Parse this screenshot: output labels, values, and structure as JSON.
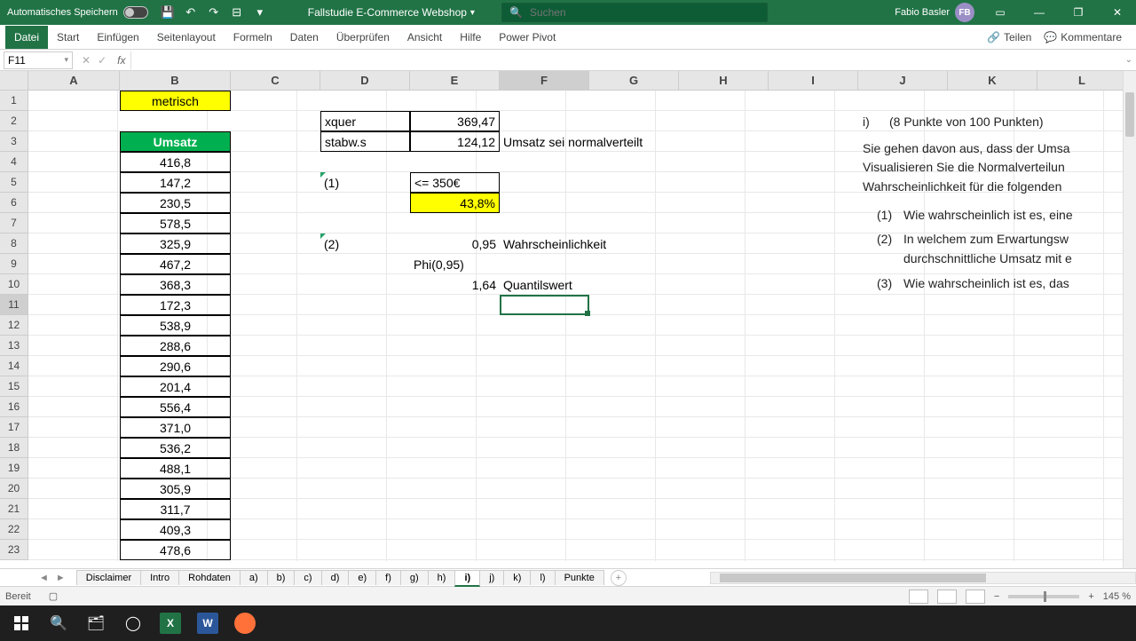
{
  "titlebar": {
    "autosave": "Automatisches Speichern",
    "doc": "Fallstudie E-Commerce Webshop",
    "search_ph": "Suchen",
    "user": "Fabio Basler",
    "initials": "FB"
  },
  "ribbon": {
    "tabs": [
      "Datei",
      "Start",
      "Einfügen",
      "Seitenlayout",
      "Formeln",
      "Daten",
      "Überprüfen",
      "Ansicht",
      "Hilfe",
      "Power Pivot"
    ],
    "share": "Teilen",
    "comments": "Kommentare"
  },
  "formula": {
    "namebox": "F11",
    "content": ""
  },
  "cols": [
    "A",
    "B",
    "C",
    "D",
    "E",
    "F",
    "G",
    "H",
    "I",
    "J",
    "K",
    "L"
  ],
  "colw": {
    "A": 103,
    "B": 125,
    "C": 101,
    "D": 101,
    "E": 101,
    "F": 101,
    "G": 101,
    "H": 101,
    "I": 101,
    "J": 101,
    "K": 101,
    "L": 101
  },
  "rowcount": 23,
  "b1": "metrisch",
  "b3": "Umsatz",
  "bvals": [
    "416,8",
    "147,2",
    "230,5",
    "578,5",
    "325,9",
    "467,2",
    "368,3",
    "172,3",
    "538,9",
    "288,6",
    "290,6",
    "201,4",
    "556,4",
    "371,0",
    "536,2",
    "488,1",
    "305,9",
    "311,7",
    "409,3",
    "478,6"
  ],
  "d2": "xquer",
  "e2": "369,47",
  "d3": "stabw.s",
  "e3": "124,12",
  "f3": "Umsatz sei normalverteilt",
  "d5": "(1)",
  "e5": "<= 350€",
  "e6": "43,8%",
  "d8": "(2)",
  "e8": "0,95",
  "f8": "Wahrscheinlichkeit",
  "e9": "Phi(0,95)",
  "e10": "1,64",
  "f10": "Quantilswert",
  "pane": {
    "i": "i)",
    "head": "(8 Punkte von 100 Punkten)",
    "p1": "Sie gehen davon aus, dass der Umsa",
    "p2": "Visualisieren Sie die Normalverteilun",
    "p3": "Wahrscheinlichkeit für die folgenden",
    "q1n": "(1)",
    "q1": "Wie wahrscheinlich ist es, eine",
    "q2n": "(2)",
    "q2a": "In welchem zum Erwartungsw",
    "q2b": "durchschnittliche Umsatz mit e",
    "q3n": "(3)",
    "q3": "Wie wahrscheinlich ist es, das"
  },
  "sheets": [
    "Disclaimer",
    "Intro",
    "Rohdaten",
    "a)",
    "b)",
    "c)",
    "d)",
    "e)",
    "f)",
    "g)",
    "h)",
    "i)",
    "j)",
    "k)",
    "l)",
    "Punkte"
  ],
  "active_sheet": "i)",
  "status": {
    "ready": "Bereit",
    "zoom": "145 %"
  }
}
